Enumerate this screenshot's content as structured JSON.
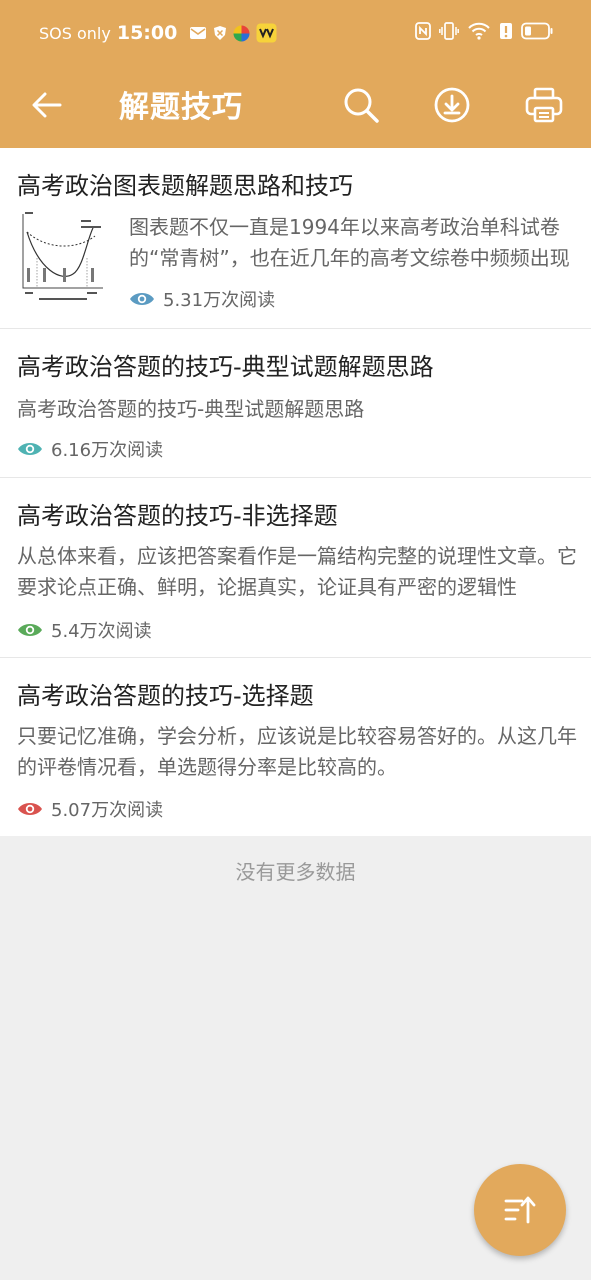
{
  "status": {
    "carrier": "SOS only",
    "time": "15:00"
  },
  "appbar": {
    "title": "解题技巧"
  },
  "articles": [
    {
      "title": "高考政治图表题解题思路和技巧",
      "desc": "图表题不仅一直是1994年以来高考政治单科试卷的“常青树”，也在近几年的高考文综卷中频频出现",
      "views": "5.31万次阅读",
      "eye_color": "#5b9bc2"
    },
    {
      "title": "高考政治答题的技巧-典型试题解题思路",
      "desc": "高考政治答题的技巧-典型试题解题思路",
      "views": "6.16万次阅读",
      "eye_color": "#4fb3b3"
    },
    {
      "title": "高考政治答题的技巧-非选择题",
      "desc": "从总体来看，应该把答案看作是一篇结构完整的说理性文章。它要求论点正确、鲜明，论据真实，论证具有严密的逻辑性",
      "views": "5.4万次阅读",
      "eye_color": "#5aaa5a"
    },
    {
      "title": "高考政治答题的技巧-选择题",
      "desc": "只要记忆准确，学会分析，应该说是比较容易答好的。从这几年的评卷情况看，单选题得分率是比较高的。",
      "views": "5.07万次阅读",
      "eye_color": "#d9534f"
    }
  ],
  "footer": {
    "no_more": "没有更多数据"
  },
  "colors": {
    "primary": "#e2a95c",
    "background": "#efefef"
  }
}
